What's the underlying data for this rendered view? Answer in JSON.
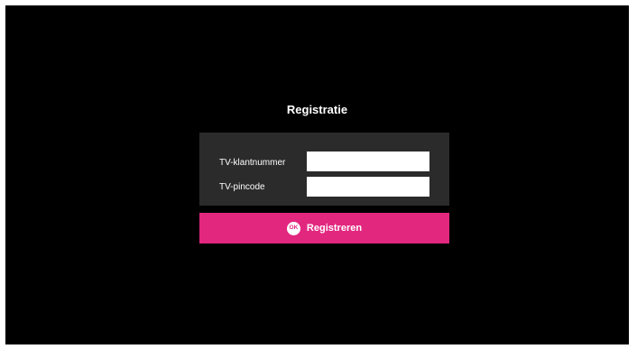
{
  "dialog": {
    "title": "Registratie"
  },
  "form": {
    "fields": [
      {
        "label": "TV-klantnummer",
        "value": "",
        "placeholder": ""
      },
      {
        "label": "TV-pincode",
        "value": "",
        "placeholder": ""
      }
    ]
  },
  "register_button": {
    "icon_text": "OK",
    "icon": "ok-remote-key-icon",
    "label": "Registreren"
  },
  "colors": {
    "background": "#000000",
    "panel": "#2b2b2b",
    "accent": "#e2277f",
    "text": "#ffffff"
  }
}
